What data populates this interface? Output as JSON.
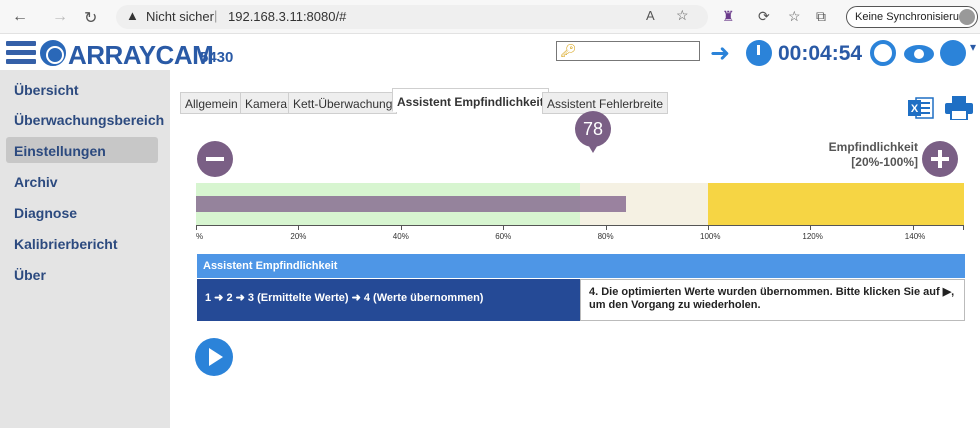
{
  "browser": {
    "security_label": "Nicht sicher",
    "url": "192.168.3.11:8080/#",
    "sync_label": "Keine Synchronisierung"
  },
  "header": {
    "brand": "ARRAYCAM",
    "model": "5430",
    "timer": "00:04:54"
  },
  "sidebar": {
    "items": [
      {
        "label": "Übersicht",
        "active": false
      },
      {
        "label": "Überwachungsbereich",
        "active": false
      },
      {
        "label": "Einstellungen",
        "active": true
      },
      {
        "label": "Archiv",
        "active": false
      },
      {
        "label": "Diagnose",
        "active": false
      },
      {
        "label": "Kalibrierbericht",
        "active": false
      },
      {
        "label": "Über",
        "active": false
      }
    ]
  },
  "tabs": [
    {
      "label": "Allgemein",
      "active": false
    },
    {
      "label": "Kamera",
      "active": false
    },
    {
      "label": "Kett-Überwachung",
      "active": false
    },
    {
      "label": "Assistent Empfindlichkeit",
      "active": true
    },
    {
      "label": "Assistent Fehlerbreite",
      "active": false
    }
  ],
  "sensitivity": {
    "value": "78",
    "label_line1": "Empfindlichkeit",
    "label_line2": "[20%-100%]",
    "bar_fraction_of_scale": 0.56,
    "scale_max_percent": 150,
    "zones": [
      {
        "from": 0,
        "to": 75,
        "color": "#d7f5d0"
      },
      {
        "from": 75,
        "to": 100,
        "color": "#f5f1e3"
      },
      {
        "from": 100,
        "to": 150,
        "color": "#f6d544"
      }
    ],
    "ticks": [
      "%",
      "20%",
      "40%",
      "60%",
      "80%",
      "100%",
      "120%",
      "140%"
    ]
  },
  "assistant": {
    "title": "Assistent Empfindlichkeit",
    "steps": "1 ➜ 2 ➜ 3 (Ermittelte Werte) ➜ 4 (Werte übernommen)",
    "message": "4. Die optimierten Werte wurden übernommen. Bitte klicken Sie auf ▶, um den Vorgang zu wiederholen."
  },
  "colors": {
    "brand_blue": "#2a5aa6",
    "accent_blue": "#2b83d9",
    "marker_purple": "#7a5f85"
  }
}
